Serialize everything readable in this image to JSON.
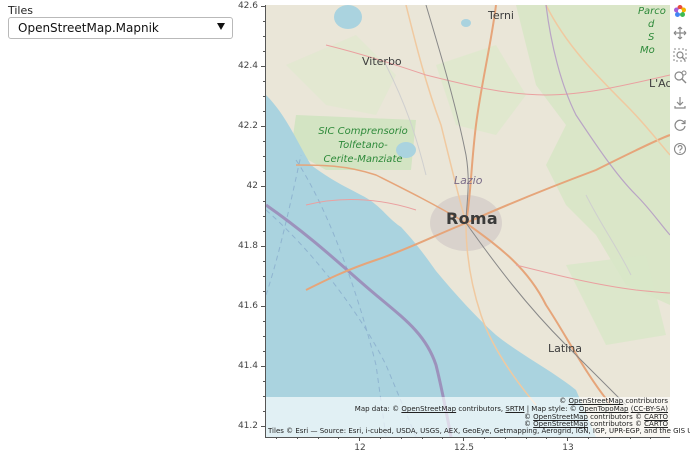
{
  "sidebar": {
    "label": "Tiles",
    "select_value": "OpenStreetMap.Mapnik"
  },
  "axes": {
    "y_ticks": [
      "42.6",
      "42.4",
      "42.2",
      "42",
      "41.8",
      "41.6",
      "41.4",
      "41.2"
    ],
    "x_ticks": [
      "12",
      "12.5",
      "13"
    ]
  },
  "map_labels": {
    "terni": "Terni",
    "viterbo": "Viterbo",
    "roma": "Roma",
    "lazio": "Lazio",
    "latina": "Latina",
    "sic_line1": "SIC Comprensorio",
    "sic_line2": "Tolfetano-",
    "sic_line3": "Cerite-Manziate",
    "parco_1": "Parco",
    "parco_2": "d",
    "parco_3": "S",
    "parco_4": "Mo",
    "laq": "L'Aq"
  },
  "attribution": {
    "line1_a": "© ",
    "line1_link": "OpenStreetMap",
    "line1_b": " contributors",
    "line2_a": "Map data: © ",
    "line2_link1": "OpenStreetMap",
    "line2_b": " contributors, ",
    "line2_link2": "SRTM",
    "line2_c": " | Map style: © ",
    "line2_link3": "OpenTopoMap",
    "line2_link4": "(CC-BY-SA)",
    "line3_a": "© ",
    "line3_link1": "OpenStreetMap",
    "line3_b": " contributors © ",
    "line3_link2": "CARTO",
    "line4_a": "© ",
    "line4_link1": "OpenStreetMap",
    "line4_b": " contributors © ",
    "line4_link2": "CARTO",
    "line5": "Tiles © Esri — Source: Esri, i-cubed, USDA, USGS, AEX, GeoEye, Getmapping, Aerogrid, IGN, IGP, UPR-EGP, and the GIS User C..."
  },
  "toolbar": {
    "tools": [
      "bokeh-logo-icon",
      "pan-icon",
      "box-zoom-icon",
      "wheel-zoom-icon",
      "save-icon",
      "reset-icon",
      "help-icon"
    ]
  }
}
